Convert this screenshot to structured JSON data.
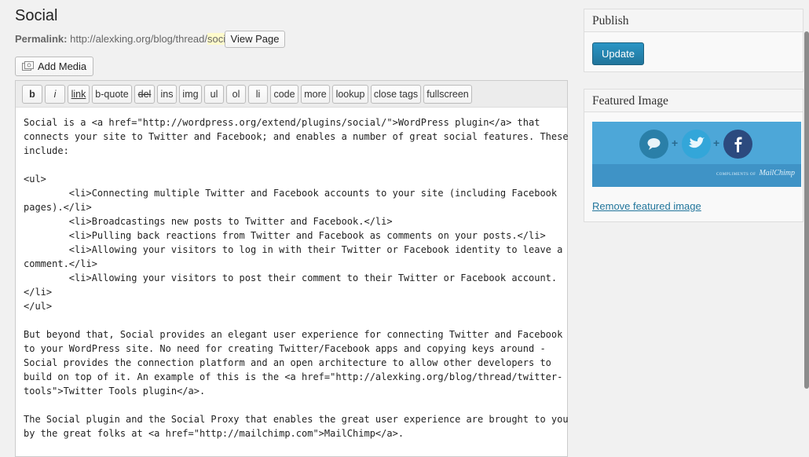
{
  "post": {
    "title": "Social",
    "permalink_label": "Permalink:",
    "permalink_base": "http://alexking.org/blog/thread/",
    "permalink_slug": "social",
    "view_page_label": "View Page"
  },
  "editor": {
    "add_media_label": "Add Media",
    "toolbar": [
      "b",
      "i",
      "link",
      "b-quote",
      "del",
      "ins",
      "img",
      "ul",
      "ol",
      "li",
      "code",
      "more",
      "lookup",
      "close tags",
      "fullscreen"
    ],
    "content": "Social is a <a href=\"http://wordpress.org/extend/plugins/social/\">WordPress plugin</a> that\nconnects your site to Twitter and Facebook; and enables a number of great social features. These\ninclude:\n\n<ul>\n        <li>Connecting multiple Twitter and Facebook accounts to your site (including Facebook\npages).</li>\n        <li>Broadcastings new posts to Twitter and Facebook.</li>\n        <li>Pulling back reactions from Twitter and Facebook as comments on your posts.</li>\n        <li>Allowing your visitors to log in with their Twitter or Facebook identity to leave a\ncomment.</li>\n        <li>Allowing your visitors to post their comment to their Twitter or Facebook account.\n</li>\n</ul>\n\nBut beyond that, Social provides an elegant user experience for connecting Twitter and Facebook\nto your WordPress site. No need for creating Twitter/Facebook apps and copying keys around -\nSocial provides the connection platform and an open architecture to allow other developers to\nbuild on top of it. An example of this is the <a href=\"http://alexking.org/blog/thread/twitter-\ntools\">Twitter Tools plugin</a>.\n\nThe Social plugin and the Social Proxy that enables the great user experience are brought to you\nby the great folks at <a href=\"http://mailchimp.com\">MailChimp</a>."
  },
  "publish": {
    "title": "Publish",
    "update_label": "Update"
  },
  "featured_image": {
    "title": "Featured Image",
    "image_credit_small": "COMPLIMENTS OF",
    "image_credit_brand": "MailChimp",
    "remove_label": "Remove featured image"
  },
  "colors": {
    "accent": "#21759b",
    "speech_bubble": "#2a7fa8",
    "twitter": "#33a6d9",
    "facebook": "#2c4a7e"
  }
}
